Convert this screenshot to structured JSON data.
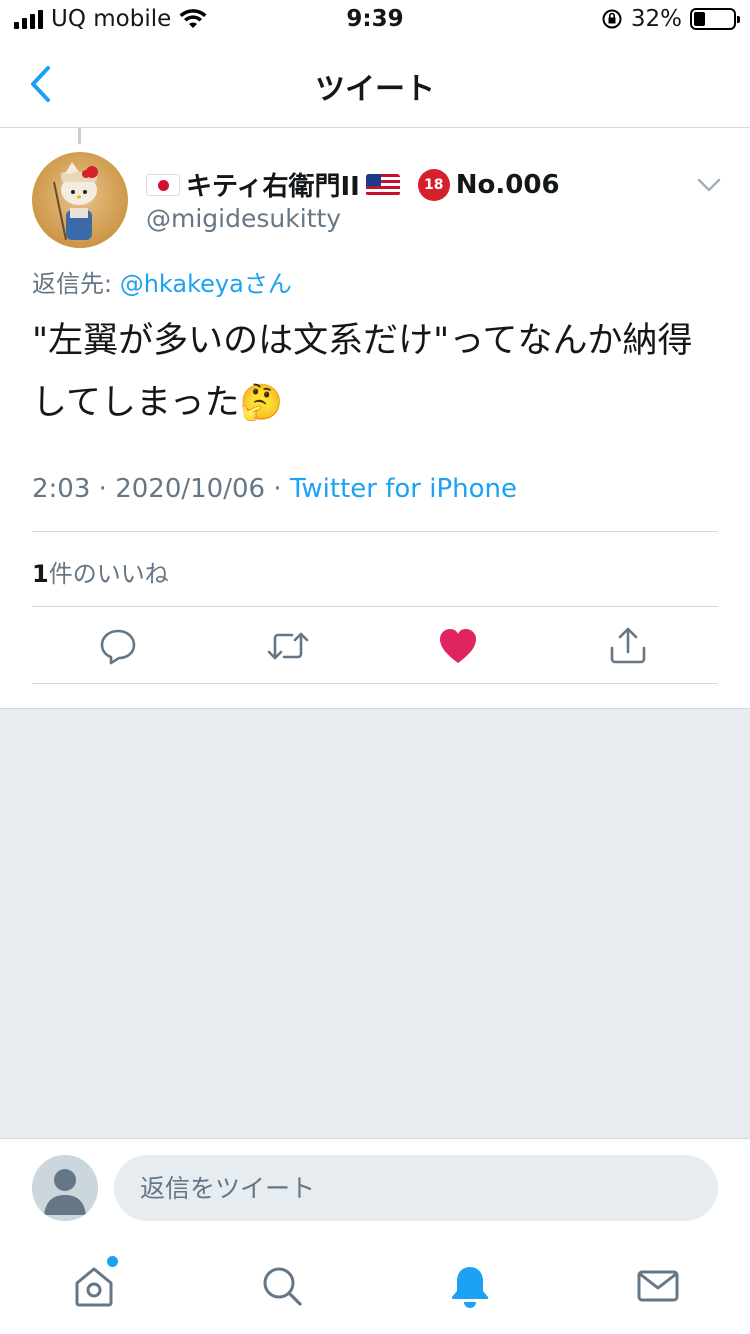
{
  "status_bar": {
    "carrier": "UQ mobile",
    "time": "9:39",
    "battery": "32%"
  },
  "nav": {
    "title": "ツイート"
  },
  "tweet": {
    "display_name": "キティ右衛門II",
    "badge_text": "No.006",
    "handle": "@migidesukitty",
    "reply_prefix": "返信先: ",
    "reply_mention": "@hkakeya",
    "reply_suffix": "さん",
    "text": "\"左翼が多いのは文系だけ\"ってなんか納得してしまった🤔",
    "time": "2:03",
    "date": "2020/10/06",
    "source": "Twitter for iPhone",
    "likes_count": "1",
    "likes_label": "件のいいね",
    "liked": true
  },
  "composer": {
    "placeholder": "返信をツイート"
  },
  "colors": {
    "accent": "#1da1f2",
    "like": "#e0245e",
    "muted": "#657786",
    "background_gray": "#e6ecf0"
  },
  "tabbar": {
    "items": [
      "home-icon",
      "search-icon",
      "notifications-icon",
      "messages-icon"
    ],
    "active": "notifications-icon"
  }
}
